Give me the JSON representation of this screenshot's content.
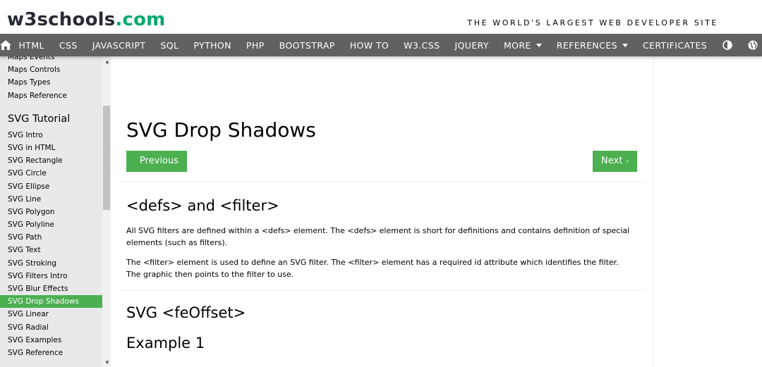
{
  "header": {
    "logo_w3": "w3schools",
    "logo_com": ".com",
    "tagline": "THE WORLD'S LARGEST WEB DEVELOPER SITE"
  },
  "navbar": {
    "items": [
      "HTML",
      "CSS",
      "JAVASCRIPT",
      "SQL",
      "PYTHON",
      "PHP",
      "BOOTSTRAP",
      "HOW TO",
      "W3.CSS",
      "JQUERY"
    ],
    "more": "MORE",
    "references": "REFERENCES",
    "certificates": "CERTIFICATES",
    "icons": [
      "home-icon",
      "contrast-icon",
      "globe-icon",
      "search-icon"
    ]
  },
  "sidebar": {
    "maps_items": [
      "Maps Events",
      "Maps Controls",
      "Maps Types",
      "Maps Reference"
    ],
    "svg_heading": "SVG Tutorial",
    "svg_items": [
      "SVG Intro",
      "SVG in HTML",
      "SVG Rectangle",
      "SVG Circle",
      "SVG Ellipse",
      "SVG Line",
      "SVG Polygon",
      "SVG Polyline",
      "SVG Path",
      "SVG Text",
      "SVG Stroking",
      "SVG Filters Intro",
      "SVG Blur Effects",
      "SVG Drop Shadows",
      "SVG Linear",
      "SVG Radial",
      "SVG Examples",
      "SVG Reference"
    ],
    "active_item": "SVG Drop Shadows"
  },
  "main": {
    "title": "SVG Drop Shadows",
    "prev_label": "Previous",
    "next_label": "Next",
    "section1_heading": "<defs> and <filter>",
    "para1": "All SVG filters are defined within a <defs> element. The <defs> element is short for definitions and contains definition of special elements (such as filters).",
    "para2": "The <filter> element is used to define an SVG filter. The <filter> element has a required id attribute which identifies the filter. The graphic then points to the filter to use.",
    "section2_heading": "SVG <feOffset>",
    "example_heading": "Example 1"
  },
  "colors": {
    "accent": "#4CAF50",
    "navbar": "#616161",
    "sidebar": "#E7E9EB"
  }
}
